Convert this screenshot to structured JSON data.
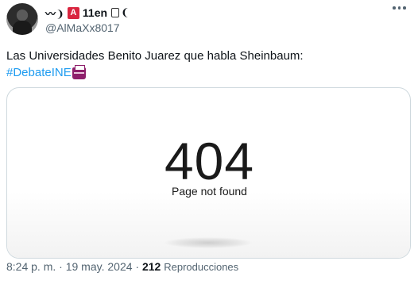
{
  "author": {
    "display_name": "11en",
    "badge_letter": "A",
    "handle": "@AlMaXx8017",
    "prefix_glyph": "〰❩",
    "suffix_glyph": "❨"
  },
  "tweet": {
    "text": "Las Universidades Benito Juarez que habla Sheinbaum:",
    "hashtag": "#DebateINE"
  },
  "card": {
    "code": "404",
    "message": "Page not found"
  },
  "meta": {
    "time": "8:24 p. m.",
    "separator": "·",
    "date": "19 may. 2024",
    "views_count": "212",
    "views_label": "Reproducciones"
  },
  "icons": {
    "more": "more-icon",
    "ballot": "ballot-box-icon"
  }
}
